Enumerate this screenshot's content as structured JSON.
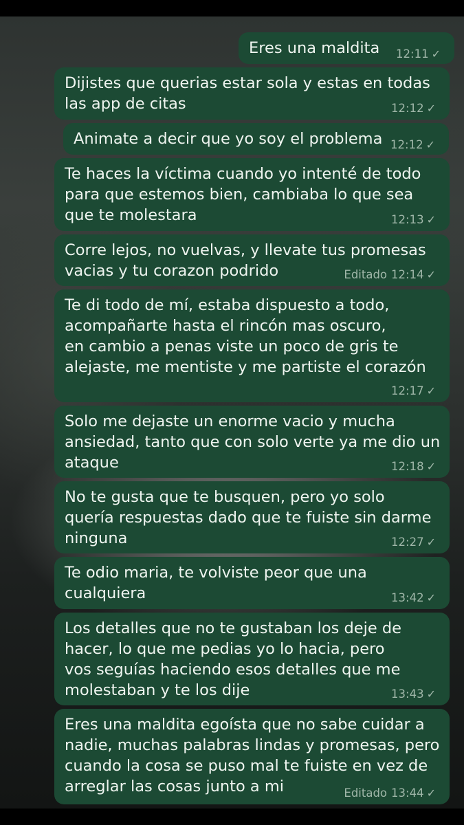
{
  "chat": {
    "messages": [
      {
        "text": "Eres una maldita",
        "time": "12:11",
        "edited": ""
      },
      {
        "text": "Dijistes que querias estar sola y estas en todas\nlas app de citas",
        "time": "12:12",
        "edited": ""
      },
      {
        "text": "Animate a decir que yo soy el problema",
        "time": "12:12",
        "edited": ""
      },
      {
        "text": "Te haces la víctima cuando yo intenté de todo\npara que estemos bien, cambiaba lo que sea\nque te molestara",
        "time": "12:13",
        "edited": ""
      },
      {
        "text": "Corre lejos, no vuelvas, y llevate tus promesas\nvacias y tu corazon podrido",
        "time": "12:14",
        "edited": "Editado"
      },
      {
        "text": "Te di todo de mí, estaba dispuesto a todo,\nacompañarte hasta el rincón mas oscuro,\nen cambio a penas viste un poco de gris te\nalejaste, me mentiste y me partiste el corazón",
        "time": "12:17",
        "edited": ""
      },
      {
        "text": "Solo me dejaste un enorme vacio y mucha\nansiedad, tanto que con solo verte ya me dio un\nataque",
        "time": "12:18",
        "edited": ""
      },
      {
        "text": "No te gusta que te busquen, pero yo solo\nquería respuestas dado que te fuiste sin darme\nninguna",
        "time": "12:27",
        "edited": ""
      },
      {
        "text": "Te odio maria, te volviste peor que una\ncualquiera",
        "time": "13:42",
        "edited": ""
      },
      {
        "text": "Los detalles que no te gustaban los deje de\nhacer, lo que me pedias yo lo hacia, pero\nvos seguías haciendo esos detalles que me\nmolestaban y te los dije",
        "time": "13:43",
        "edited": ""
      },
      {
        "text": "Eres una maldita egoísta que no sabe cuidar a\nnadie, muchas palabras lindas y promesas, pero\ncuando la cosa se puso mal te fuiste en vez de\narreglar las cosas junto a mi",
        "time": "13:44",
        "edited": "Editado"
      }
    ]
  },
  "colors": {
    "bubble_outgoing": "#1c4a34",
    "text": "#eef4ef",
    "meta": "#b6c9bb"
  },
  "icons": {
    "sent_check": "✓"
  }
}
